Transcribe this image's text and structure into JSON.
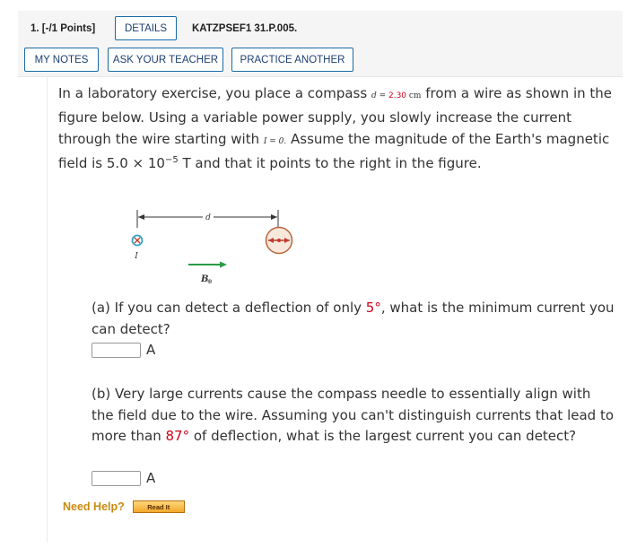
{
  "header": {
    "points": "1. [-/1 Points]",
    "details_label": "DETAILS",
    "problem_code": "KATZPSEF1 31.P.005.",
    "my_notes_label": "MY NOTES",
    "ask_teacher_label": "ASK YOUR TEACHER",
    "practice_label": "PRACTICE ANOTHER"
  },
  "problem": {
    "text_1": "In a laboratory exercise, you place a compass ",
    "d_var": "d",
    "d_eq": " = ",
    "d_value": "2.30",
    "d_unit": " cm",
    "text_2": " from a wire as shown in the figure below. Using a variable power supply, you slowly increase the current through the wire starting with ",
    "i_eq": "I = 0.",
    "text_3": " Assume the magnitude of the Earth's magnetic field is 5.0 × 10",
    "exp": "−5",
    "text_4": " T and that it points to the right in the figure."
  },
  "figure": {
    "d_label": "d",
    "current_label": "I",
    "field_label": "B",
    "field_subscript": "⊕",
    "colors": {
      "arrow": "#2a9a48",
      "compass_fill": "#f8e8dc",
      "compass_stroke": "#b5673e",
      "needle": "#c0392b",
      "wire": "#3aa0c6"
    }
  },
  "part_a": {
    "text_1": "(a) If you can detect a deflection of only ",
    "angle": "5°",
    "text_2": ", what is the minimum current you can detect?",
    "unit": "A",
    "value": ""
  },
  "part_b": {
    "text_1": "(b) Very large currents cause the compass needle to essentially align with the field due to the wire. Assuming you can't distinguish currents that lead to more than ",
    "angle": "87°",
    "text_2": " of deflection, what is the largest current you can detect?",
    "unit": "A",
    "value": ""
  },
  "help": {
    "label": "Need Help?",
    "read_it": "Read It"
  }
}
